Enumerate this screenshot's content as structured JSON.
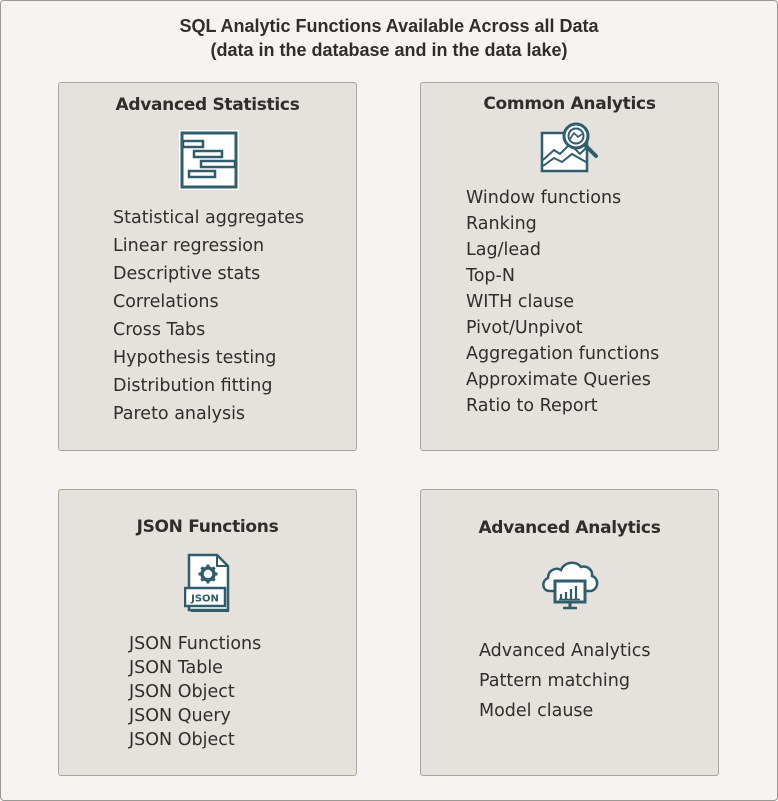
{
  "title": {
    "line1": "SQL Analytic Functions Available Across all Data",
    "line2": "(data in the database and in the data lake)"
  },
  "colors": {
    "background": "#f5f4f2",
    "panel": "#e5e2de",
    "text": "#312d2a",
    "icon": "#2f5d6b"
  },
  "panels": [
    {
      "title": "Advanced Statistics",
      "icon": "gantt-chart-icon",
      "items": [
        "Statistical aggregates",
        "Linear regression",
        "Descriptive stats",
        "Correlations",
        "Cross Tabs",
        "Hypothesis testing",
        "Distribution fitting",
        "Pareto analysis"
      ]
    },
    {
      "title": "Common Analytics",
      "icon": "chart-magnifier-icon",
      "items": [
        "Window functions",
        "Ranking",
        "Lag/lead",
        "Top-N",
        "WITH clause",
        "Pivot/Unpivot",
        "Aggregation functions",
        "Approximate Queries",
        "Ratio to Report"
      ]
    },
    {
      "title": "JSON Functions",
      "icon": "json-document-icon",
      "icon_label": "JSON",
      "items": [
        "JSON Functions",
        "JSON Table",
        "JSON Object",
        "JSON Query",
        "JSON Object"
      ]
    },
    {
      "title": "Advanced Analytics",
      "icon": "cloud-monitor-icon",
      "items": [
        "Advanced Analytics",
        "Pattern matching",
        "Model clause"
      ]
    }
  ]
}
